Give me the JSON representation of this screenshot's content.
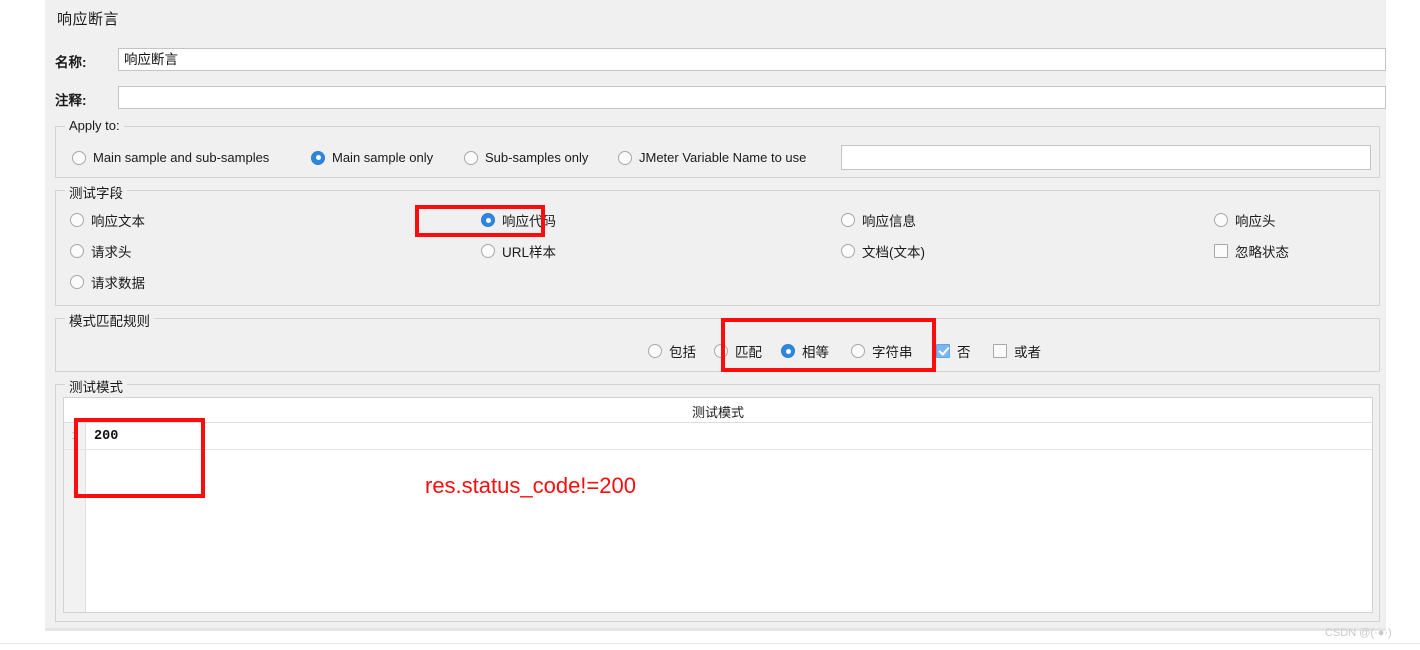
{
  "panel": {
    "title": "响应断言"
  },
  "name_row": {
    "label": "名称:",
    "value": "响应断言"
  },
  "comment_row": {
    "label": "注释:",
    "value": "",
    "placeholder": ""
  },
  "apply_to": {
    "group_title": "Apply to:",
    "options": [
      {
        "label": "Main sample and sub-samples",
        "selected": false
      },
      {
        "label": "Main sample only",
        "selected": true
      },
      {
        "label": "Sub-samples only",
        "selected": false
      },
      {
        "label": "JMeter Variable Name to use",
        "selected": false
      }
    ],
    "variable_name_value": ""
  },
  "test_field": {
    "group_title": "测试字段",
    "options": [
      {
        "label": "响应文本",
        "type": "radio",
        "selected": false
      },
      {
        "label": "请求头",
        "type": "radio",
        "selected": false
      },
      {
        "label": "请求数据",
        "type": "radio",
        "selected": false
      },
      {
        "label": "响应代码",
        "type": "radio",
        "selected": true
      },
      {
        "label": "URL样本",
        "type": "radio",
        "selected": false
      },
      {
        "label": "响应信息",
        "type": "radio",
        "selected": false
      },
      {
        "label": "文档(文本)",
        "type": "radio",
        "selected": false
      },
      {
        "label": "响应头",
        "type": "radio",
        "selected": false
      },
      {
        "label": "忽略状态",
        "type": "checkbox",
        "checked": false
      }
    ]
  },
  "pattern_rules": {
    "group_title": "模式匹配规则",
    "options": [
      {
        "label": "包括",
        "type": "radio",
        "selected": false
      },
      {
        "label": "匹配",
        "type": "radio",
        "selected": false
      },
      {
        "label": "相等",
        "type": "radio",
        "selected": true
      },
      {
        "label": "字符串",
        "type": "radio",
        "selected": false
      },
      {
        "label": "否",
        "type": "checkbox",
        "checked": true
      },
      {
        "label": "或者",
        "type": "checkbox",
        "checked": false
      }
    ]
  },
  "test_patterns": {
    "group_title": "测试模式",
    "column_header": "测试模式",
    "rows": [
      {
        "num": "1",
        "value": "200"
      }
    ]
  },
  "annotations": {
    "callout_text": "res.status_code!=200",
    "color": "#fb0d0d"
  },
  "watermark": {
    "text": "CSDN @(·●·)"
  }
}
